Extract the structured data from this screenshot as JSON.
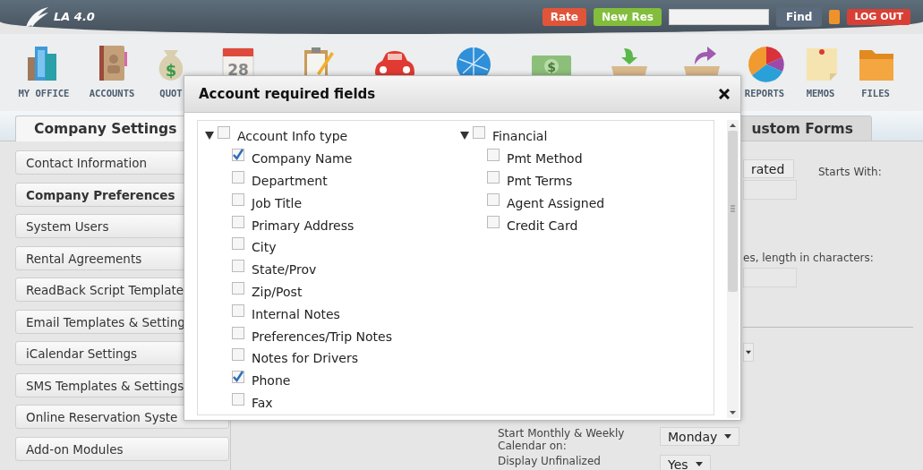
{
  "app": {
    "logo": "LA 4.0"
  },
  "header_actions": {
    "rate": "Rate",
    "new_res": "New Res",
    "find": "Find",
    "logout": "LOG OUT"
  },
  "toolbar": [
    {
      "kind": "building",
      "label": "MY OFFICE"
    },
    {
      "kind": "book",
      "label": "ACCOUNTS"
    },
    {
      "kind": "money_bag",
      "label": "QUOT",
      "symbol": "$"
    },
    {
      "kind": "calendar",
      "icon_text": "28"
    },
    {
      "kind": "clipboard"
    },
    {
      "kind": "car"
    },
    {
      "kind": "globe"
    },
    {
      "kind": "cash",
      "symbol": "$"
    },
    {
      "kind": "inbox"
    },
    {
      "kind": "outbox"
    },
    {
      "kind": "pie",
      "label": "REPORTS"
    },
    {
      "kind": "memo",
      "label": "MEMOS"
    },
    {
      "kind": "folder",
      "label": "FILES"
    }
  ],
  "tabs": [
    {
      "label": "Company Settings",
      "selected": true
    },
    {
      "label": "ustom Forms",
      "selected": false
    }
  ],
  "sidebar": {
    "items": [
      {
        "label": "Contact Information",
        "selected": false
      },
      {
        "label": "Company Preferences",
        "selected": true
      },
      {
        "label": "System Users",
        "selected": false
      },
      {
        "label": "Rental Agreements",
        "selected": false
      },
      {
        "label": "ReadBack Script Template",
        "selected": false
      },
      {
        "label": "Email Templates & Setting",
        "selected": false
      },
      {
        "label": "iCalendar Settings",
        "selected": false
      },
      {
        "label": "SMS Templates & Settings",
        "selected": false
      },
      {
        "label": "Online Reservation Syste",
        "selected": false
      },
      {
        "label": "Add-on Modules",
        "selected": false
      }
    ]
  },
  "panel": {
    "numbering_select": "rated",
    "starts_with_label": "Starts With:",
    "length_label": "es, length in characters:",
    "calendar_start": {
      "label": "Start Monthly & Weekly Calendar on:",
      "value": "Monday"
    },
    "unfinalized": {
      "label": "Display Unfinalized",
      "value": "Yes"
    }
  },
  "modal": {
    "title": "Account required fields",
    "groups": [
      {
        "label": "Account Info type",
        "expanded": true,
        "checked": false,
        "children": [
          {
            "label": "Company Name",
            "checked": true
          },
          {
            "label": "Department",
            "checked": false
          },
          {
            "label": "Job Title",
            "checked": false
          },
          {
            "label": "Primary Address",
            "checked": false
          },
          {
            "label": "City",
            "checked": false
          },
          {
            "label": "State/Prov",
            "checked": false
          },
          {
            "label": "Zip/Post",
            "checked": false
          },
          {
            "label": "Internal Notes",
            "checked": false
          },
          {
            "label": "Preferences/Trip Notes",
            "checked": false
          },
          {
            "label": "Notes for Drivers",
            "checked": false
          },
          {
            "label": "Phone",
            "checked": true
          },
          {
            "label": "Fax",
            "checked": false
          }
        ]
      },
      {
        "label": "Financial",
        "expanded": true,
        "checked": false,
        "children": [
          {
            "label": "Pmt Method",
            "checked": false
          },
          {
            "label": "Pmt Terms",
            "checked": false
          },
          {
            "label": "Agent Assigned",
            "checked": false
          },
          {
            "label": "Credit Card",
            "checked": false
          }
        ]
      }
    ]
  }
}
